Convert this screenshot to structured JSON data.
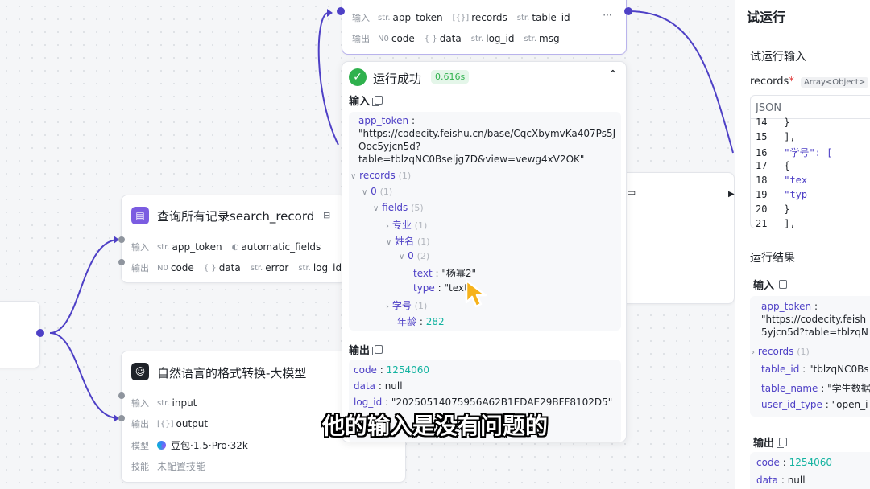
{
  "top_node": {
    "input_label": "输入",
    "output_label": "输出",
    "inputs": [
      {
        "type": "str.",
        "name": "app_token"
      },
      {
        "type": "[{}]",
        "name": "records"
      },
      {
        "type": "str.",
        "name": "table_id"
      }
    ],
    "outputs": [
      {
        "type": "N0",
        "name": "code"
      },
      {
        "type": "{ }",
        "name": "data"
      },
      {
        "type": "str.",
        "name": "log_id"
      },
      {
        "type": "str.",
        "name": "msg"
      }
    ],
    "more": "···"
  },
  "run_panel": {
    "status": "运行成功",
    "time": "0.616s",
    "input_title": "输入",
    "input_json": {
      "app_token_key": "app_token",
      "app_token_lines": [
        "\"https://codecity.feishu.cn/base/CqcXbymvKa407Ps5J",
        "Ooc5yjcn5d?",
        "table=tblzqNC0Bseljg7D&view=vewg4xV2OK\""
      ],
      "records_key": "records",
      "records_count": "(1)",
      "idx0": "0",
      "idx0_count": "(1)",
      "fields_key": "fields",
      "fields_count": "(5)",
      "major_key": "专业",
      "major_count": "(1)",
      "name_key": "姓名",
      "name_count": "(1)",
      "name_idx": "0",
      "name_idx_count": "(2)",
      "text_key": "text",
      "text_value": "\"杨幂2\"",
      "type_key": "type",
      "type_value": "\"text\"",
      "student_no_key": "学号",
      "student_no_count": "(1)",
      "age_key": "年龄",
      "age_value": "282"
    },
    "output_title": "输出",
    "output_json": {
      "code_key": "code",
      "code_value": "1254060",
      "data_key": "data",
      "data_value": "null",
      "log_id_key": "log_id",
      "log_id_value": "\"20250514075956A62B1EDAE29BFF8102D5\""
    }
  },
  "search_node": {
    "title": "查询所有记录search_record",
    "input_label": "输入",
    "output_label": "输出",
    "inputs": [
      {
        "type": "str.",
        "name": "app_token"
      },
      {
        "type": "◐",
        "name": "automatic_fields"
      }
    ],
    "outputs": [
      {
        "type": "N0",
        "name": "code"
      },
      {
        "type": "{ }",
        "name": "data"
      },
      {
        "type": "str.",
        "name": "error"
      },
      {
        "type": "str.",
        "name": "log_id"
      }
    ]
  },
  "llm_node": {
    "title": "自然语言的格式转换-大模型",
    "input_label": "输入",
    "output_label": "输出",
    "model_label": "模型",
    "skill_label": "技能",
    "input": {
      "type": "str.",
      "name": "input"
    },
    "output": {
      "type": "[{}]",
      "name": "output"
    },
    "model": "豆包·1.5·Pro·32k",
    "skill": "未配置技能"
  },
  "sidebar": {
    "title": "试运行",
    "run_input": "试运行输入",
    "records_label": "records",
    "required": "*",
    "records_type": "Array<Object>",
    "json_label": "JSON",
    "code_lines": [
      {
        "n": "14",
        "c": "          }"
      },
      {
        "n": "15",
        "c": "        ],"
      },
      {
        "n": "16",
        "c": "        \"学号\": ["
      },
      {
        "n": "17",
        "c": "          {"
      },
      {
        "n": "18",
        "c": "            \"tex"
      },
      {
        "n": "19",
        "c": "            \"typ"
      },
      {
        "n": "20",
        "c": "          }"
      },
      {
        "n": "21",
        "c": "        ],"
      }
    ],
    "result_title": "运行结果",
    "input_title": "输入",
    "res_app_token_key": "app_token",
    "res_app_token_lines": [
      "\"https://codecity.feish",
      "5yjcn5d?table=tblzqN"
    ],
    "res_records": "records",
    "res_records_count": "(1)",
    "res_table_id_key": "table_id",
    "res_table_id_value": "\"tblzqNC0Bs",
    "res_table_name_key": "table_name",
    "res_table_name_value": "\"学生数据",
    "res_user_id_key": "user_id_type",
    "res_user_id_value": "\"open_i",
    "output_title": "输出",
    "out_code_key": "code",
    "out_code_value": "1254060",
    "out_data_key": "data",
    "out_data_value": "null"
  },
  "subtitle": "他的输入是没有问题的"
}
